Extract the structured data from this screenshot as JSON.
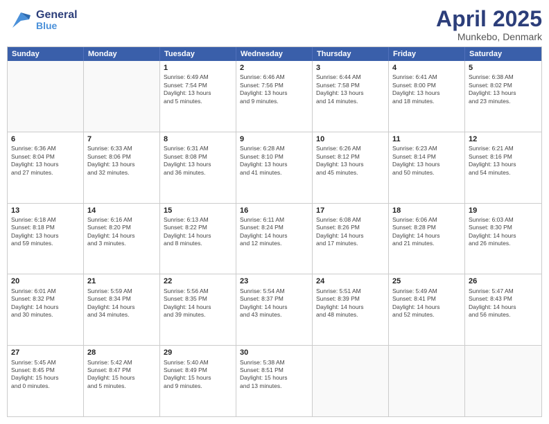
{
  "header": {
    "logo_general": "General",
    "logo_blue": "Blue",
    "month_title": "April 2025",
    "location": "Munkebo, Denmark"
  },
  "weekdays": [
    "Sunday",
    "Monday",
    "Tuesday",
    "Wednesday",
    "Thursday",
    "Friday",
    "Saturday"
  ],
  "rows": [
    [
      {
        "day": "",
        "info": "",
        "empty": true
      },
      {
        "day": "",
        "info": "",
        "empty": true
      },
      {
        "day": "1",
        "info": "Sunrise: 6:49 AM\nSunset: 7:54 PM\nDaylight: 13 hours\nand 5 minutes."
      },
      {
        "day": "2",
        "info": "Sunrise: 6:46 AM\nSunset: 7:56 PM\nDaylight: 13 hours\nand 9 minutes."
      },
      {
        "day": "3",
        "info": "Sunrise: 6:44 AM\nSunset: 7:58 PM\nDaylight: 13 hours\nand 14 minutes."
      },
      {
        "day": "4",
        "info": "Sunrise: 6:41 AM\nSunset: 8:00 PM\nDaylight: 13 hours\nand 18 minutes."
      },
      {
        "day": "5",
        "info": "Sunrise: 6:38 AM\nSunset: 8:02 PM\nDaylight: 13 hours\nand 23 minutes."
      }
    ],
    [
      {
        "day": "6",
        "info": "Sunrise: 6:36 AM\nSunset: 8:04 PM\nDaylight: 13 hours\nand 27 minutes."
      },
      {
        "day": "7",
        "info": "Sunrise: 6:33 AM\nSunset: 8:06 PM\nDaylight: 13 hours\nand 32 minutes."
      },
      {
        "day": "8",
        "info": "Sunrise: 6:31 AM\nSunset: 8:08 PM\nDaylight: 13 hours\nand 36 minutes."
      },
      {
        "day": "9",
        "info": "Sunrise: 6:28 AM\nSunset: 8:10 PM\nDaylight: 13 hours\nand 41 minutes."
      },
      {
        "day": "10",
        "info": "Sunrise: 6:26 AM\nSunset: 8:12 PM\nDaylight: 13 hours\nand 45 minutes."
      },
      {
        "day": "11",
        "info": "Sunrise: 6:23 AM\nSunset: 8:14 PM\nDaylight: 13 hours\nand 50 minutes."
      },
      {
        "day": "12",
        "info": "Sunrise: 6:21 AM\nSunset: 8:16 PM\nDaylight: 13 hours\nand 54 minutes."
      }
    ],
    [
      {
        "day": "13",
        "info": "Sunrise: 6:18 AM\nSunset: 8:18 PM\nDaylight: 13 hours\nand 59 minutes."
      },
      {
        "day": "14",
        "info": "Sunrise: 6:16 AM\nSunset: 8:20 PM\nDaylight: 14 hours\nand 3 minutes."
      },
      {
        "day": "15",
        "info": "Sunrise: 6:13 AM\nSunset: 8:22 PM\nDaylight: 14 hours\nand 8 minutes."
      },
      {
        "day": "16",
        "info": "Sunrise: 6:11 AM\nSunset: 8:24 PM\nDaylight: 14 hours\nand 12 minutes."
      },
      {
        "day": "17",
        "info": "Sunrise: 6:08 AM\nSunset: 8:26 PM\nDaylight: 14 hours\nand 17 minutes."
      },
      {
        "day": "18",
        "info": "Sunrise: 6:06 AM\nSunset: 8:28 PM\nDaylight: 14 hours\nand 21 minutes."
      },
      {
        "day": "19",
        "info": "Sunrise: 6:03 AM\nSunset: 8:30 PM\nDaylight: 14 hours\nand 26 minutes."
      }
    ],
    [
      {
        "day": "20",
        "info": "Sunrise: 6:01 AM\nSunset: 8:32 PM\nDaylight: 14 hours\nand 30 minutes."
      },
      {
        "day": "21",
        "info": "Sunrise: 5:59 AM\nSunset: 8:34 PM\nDaylight: 14 hours\nand 34 minutes."
      },
      {
        "day": "22",
        "info": "Sunrise: 5:56 AM\nSunset: 8:35 PM\nDaylight: 14 hours\nand 39 minutes."
      },
      {
        "day": "23",
        "info": "Sunrise: 5:54 AM\nSunset: 8:37 PM\nDaylight: 14 hours\nand 43 minutes."
      },
      {
        "day": "24",
        "info": "Sunrise: 5:51 AM\nSunset: 8:39 PM\nDaylight: 14 hours\nand 48 minutes."
      },
      {
        "day": "25",
        "info": "Sunrise: 5:49 AM\nSunset: 8:41 PM\nDaylight: 14 hours\nand 52 minutes."
      },
      {
        "day": "26",
        "info": "Sunrise: 5:47 AM\nSunset: 8:43 PM\nDaylight: 14 hours\nand 56 minutes."
      }
    ],
    [
      {
        "day": "27",
        "info": "Sunrise: 5:45 AM\nSunset: 8:45 PM\nDaylight: 15 hours\nand 0 minutes."
      },
      {
        "day": "28",
        "info": "Sunrise: 5:42 AM\nSunset: 8:47 PM\nDaylight: 15 hours\nand 5 minutes."
      },
      {
        "day": "29",
        "info": "Sunrise: 5:40 AM\nSunset: 8:49 PM\nDaylight: 15 hours\nand 9 minutes."
      },
      {
        "day": "30",
        "info": "Sunrise: 5:38 AM\nSunset: 8:51 PM\nDaylight: 15 hours\nand 13 minutes."
      },
      {
        "day": "",
        "info": "",
        "empty": true
      },
      {
        "day": "",
        "info": "",
        "empty": true
      },
      {
        "day": "",
        "info": "",
        "empty": true
      }
    ]
  ]
}
